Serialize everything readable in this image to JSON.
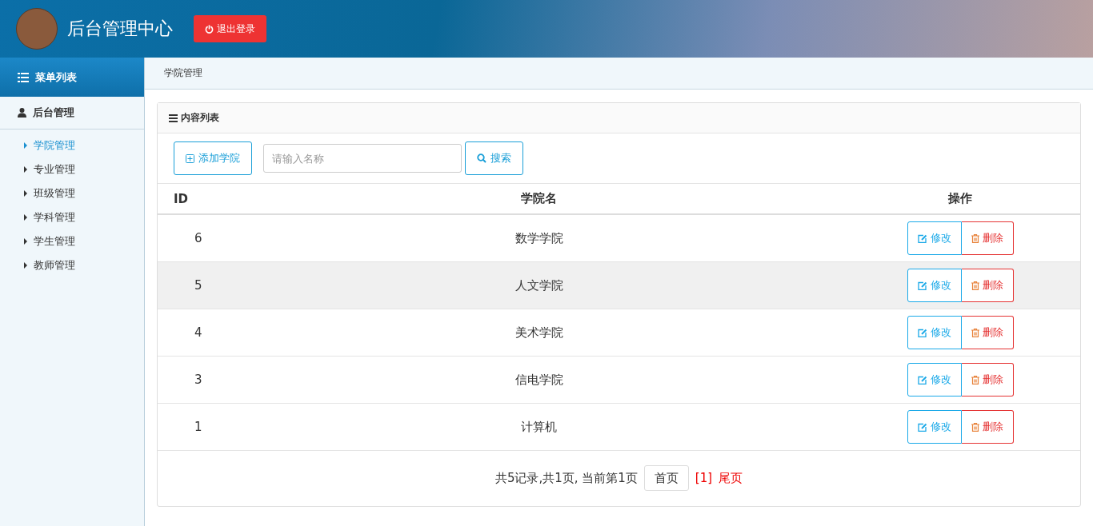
{
  "header": {
    "title": "后台管理中心",
    "logout": "退出登录"
  },
  "sidebar": {
    "heading": "菜单列表",
    "group": "后台管理",
    "items": [
      {
        "label": "学院管理",
        "selected": true
      },
      {
        "label": "专业管理",
        "selected": false
      },
      {
        "label": "班级管理",
        "selected": false
      },
      {
        "label": "学科管理",
        "selected": false
      },
      {
        "label": "学生管理",
        "selected": false
      },
      {
        "label": "教师管理",
        "selected": false
      }
    ]
  },
  "breadcrumb": "学院管理",
  "panel": {
    "title": "内容列表",
    "add_button": "添加学院",
    "search": {
      "placeholder": "请输入名称"
    },
    "search_button": "搜索"
  },
  "table": {
    "columns": [
      "ID",
      "学院名",
      "操作"
    ],
    "rows": [
      {
        "id": "6",
        "name": "数学学院",
        "edit": "修改",
        "delete": "删除",
        "highlighted": false
      },
      {
        "id": "5",
        "name": "人文学院",
        "edit": "修改",
        "delete": "删除",
        "highlighted": true
      },
      {
        "id": "4",
        "name": "美术学院",
        "edit": "修改",
        "delete": "删除",
        "highlighted": false
      },
      {
        "id": "3",
        "name": "信电学院",
        "edit": "修改",
        "delete": "删除",
        "highlighted": false
      },
      {
        "id": "1",
        "name": "计算机",
        "edit": "修改",
        "delete": "删除",
        "highlighted": false
      }
    ]
  },
  "pagination": {
    "summary": "共5记录,共1页, 当前第1页",
    "first": "首页",
    "current": "[1]",
    "last": "尾页"
  }
}
